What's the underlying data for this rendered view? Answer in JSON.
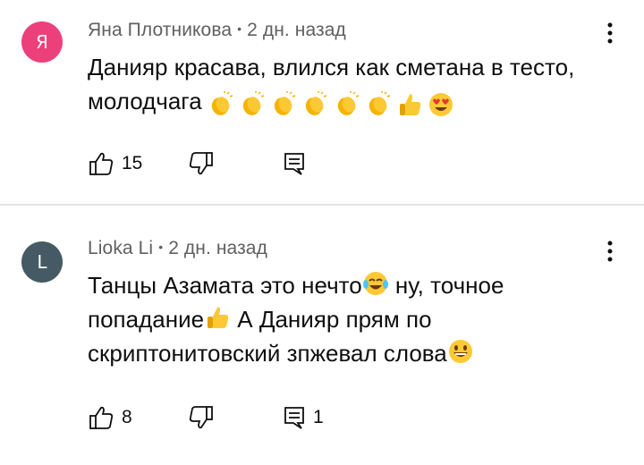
{
  "comments": [
    {
      "avatar_letter": "Я",
      "avatar_color": "#ec407a",
      "author": "Яна Плотникова",
      "separator": "•",
      "time": "2 дн. назад",
      "text": "Данияр красава, влился как сметана в тесто, молодчага",
      "emojis": [
        "clapping-hands",
        "clapping-hands",
        "clapping-hands",
        "clapping-hands",
        "clapping-hands",
        "clapping-hands",
        "thumbs-up",
        "heart-eyes"
      ],
      "likes": "15",
      "replies": ""
    },
    {
      "avatar_letter": "L",
      "avatar_color": "#455a64",
      "author": "Lioka Li",
      "separator": "•",
      "time": "2 дн. назад",
      "text_part1": "Танцы Азамата это нечто",
      "text_part2": " ну, точное попадание",
      "text_part3": " А Данияр прям по скриптонитовский зпжевал слова",
      "emojis": [
        "tears-of-joy",
        "thumbs-up",
        "grinning-face"
      ],
      "likes": "8",
      "replies": "1"
    }
  ],
  "icons": {
    "like": "thumbs-up-outline-icon",
    "dislike": "thumbs-down-outline-icon",
    "reply": "comment-icon",
    "menu": "more-vertical-icon"
  }
}
